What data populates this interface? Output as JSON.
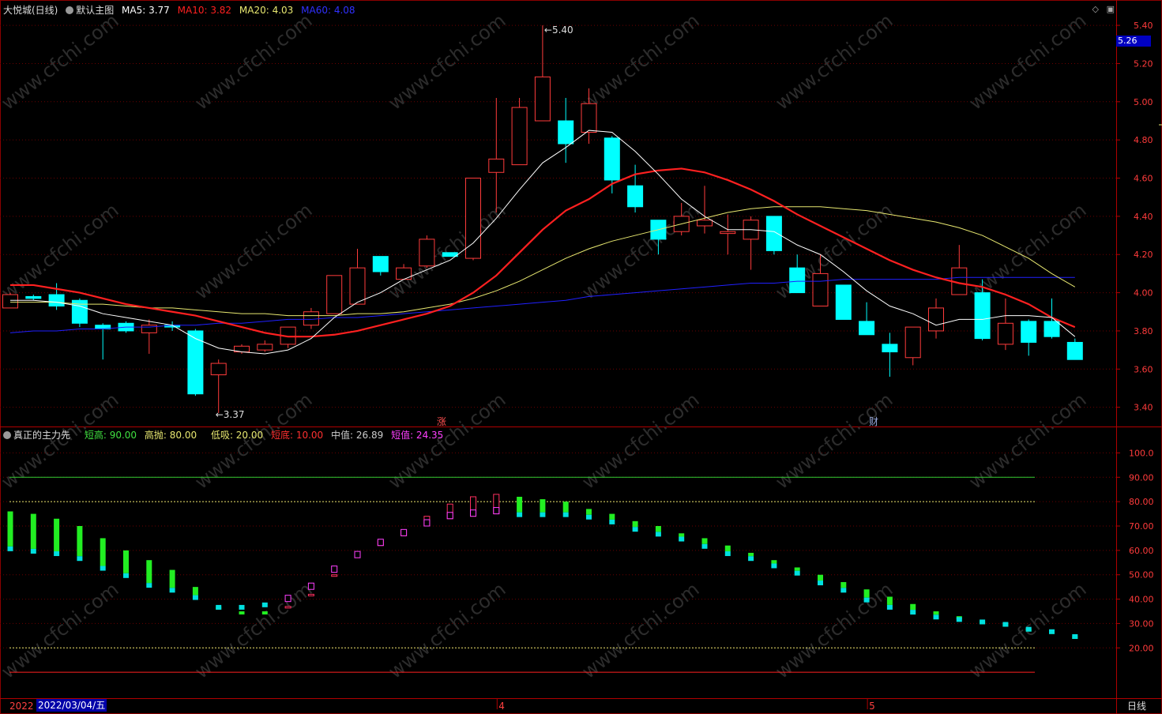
{
  "main_header": {
    "title": "大悦城(日线)",
    "template": "默认主图",
    "ma5": "MA5: 3.77",
    "ma10": "MA10: 3.82",
    "ma20": "MA20: 4.03",
    "ma60": "MA60: 4.08"
  },
  "indicator_header": {
    "name": "真正的主力先",
    "short_high": "短高: 90.00",
    "high_throw": "高抛: 80.00",
    "low_buy": "低吸: 20.00",
    "short_bottom": "短底: 10.00",
    "mid_value": "中值: 26.89",
    "short_value": "短值: 24.35"
  },
  "current_price": "5.26",
  "price_axis": [
    "5.40",
    "5.20",
    "5.00",
    "4.80",
    "4.60",
    "4.40",
    "4.20",
    "4.00",
    "3.80",
    "3.60",
    "3.40"
  ],
  "ind_axis": [
    "100.0",
    "90.00",
    "80.00",
    "70.00",
    "60.00",
    "50.00",
    "40.00",
    "30.00",
    "20.00"
  ],
  "annotations": {
    "high": "5.40",
    "low": "3.37",
    "mark1": "涨",
    "mark2": "财"
  },
  "date_prefix": "2022",
  "cursor_date": "2022/03/04/五",
  "x_labels": [
    "4",
    "5"
  ],
  "period": "日线",
  "watermark": "www.cfchi.com",
  "colors": {
    "up": "#ff3b3b",
    "down": "#00ffff",
    "ma5": "#ffffff",
    "ma10": "#ff2020",
    "ma20": "#e8e870",
    "ma60": "#2020ff"
  },
  "chart_data": {
    "type": "candlestick",
    "ohlc": [
      [
        3.92,
        3.99,
        3.92,
        4.0
      ],
      [
        3.98,
        3.97,
        3.96,
        3.99
      ],
      [
        3.99,
        3.93,
        3.91,
        4.05
      ],
      [
        3.96,
        3.84,
        3.82,
        3.97
      ],
      [
        3.83,
        3.81,
        3.65,
        3.84
      ],
      [
        3.84,
        3.8,
        3.79,
        3.85
      ],
      [
        3.79,
        3.83,
        3.68,
        3.86
      ],
      [
        3.83,
        3.82,
        3.8,
        3.85
      ],
      [
        3.8,
        3.47,
        3.46,
        3.81
      ],
      [
        3.57,
        3.63,
        3.37,
        3.65
      ],
      [
        3.69,
        3.72,
        3.68,
        3.73
      ],
      [
        3.7,
        3.73,
        3.69,
        3.75
      ],
      [
        3.73,
        3.82,
        3.71,
        3.82
      ],
      [
        3.83,
        3.9,
        3.81,
        3.92
      ],
      [
        3.89,
        4.09,
        3.89,
        4.09
      ],
      [
        3.94,
        4.13,
        3.94,
        4.23
      ],
      [
        4.19,
        4.11,
        4.09,
        4.19
      ],
      [
        4.07,
        4.13,
        4.07,
        4.15
      ],
      [
        4.14,
        4.28,
        4.13,
        4.3
      ],
      [
        4.21,
        4.19,
        4.19,
        4.21
      ],
      [
        4.18,
        4.6,
        4.17,
        4.6
      ],
      [
        4.63,
        4.7,
        4.42,
        5.02
      ],
      [
        4.67,
        4.97,
        4.67,
        5.02
      ],
      [
        4.9,
        5.13,
        4.9,
        5.4
      ],
      [
        4.9,
        4.78,
        4.68,
        5.02
      ],
      [
        4.84,
        4.99,
        4.78,
        5.07
      ],
      [
        4.81,
        4.59,
        4.52,
        4.82
      ],
      [
        4.56,
        4.45,
        4.42,
        4.67
      ],
      [
        4.38,
        4.28,
        4.2,
        4.38
      ],
      [
        4.32,
        4.4,
        4.3,
        4.47
      ],
      [
        4.35,
        4.38,
        4.31,
        4.56
      ],
      [
        4.31,
        4.32,
        4.2,
        4.41
      ],
      [
        4.28,
        4.38,
        4.12,
        4.4
      ],
      [
        4.4,
        4.22,
        4.2,
        4.4
      ],
      [
        4.13,
        4.0,
        4.0,
        4.2
      ],
      [
        3.93,
        4.1,
        3.93,
        4.2
      ],
      [
        4.04,
        3.86,
        3.86,
        4.04
      ],
      [
        3.85,
        3.78,
        3.78,
        3.95
      ],
      [
        3.73,
        3.69,
        3.56,
        3.79
      ],
      [
        3.66,
        3.82,
        3.62,
        3.82
      ],
      [
        3.8,
        3.92,
        3.76,
        3.97
      ],
      [
        3.99,
        4.13,
        3.99,
        4.25
      ],
      [
        4.0,
        3.76,
        3.75,
        4.07
      ],
      [
        3.73,
        3.84,
        3.7,
        3.97
      ],
      [
        3.85,
        3.74,
        3.67,
        3.86
      ],
      [
        3.85,
        3.77,
        3.76,
        3.97
      ],
      [
        3.74,
        3.65,
        3.65,
        3.76
      ]
    ],
    "ma5": [
      3.96,
      3.96,
      3.95,
      3.93,
      3.89,
      3.87,
      3.85,
      3.83,
      3.76,
      3.71,
      3.69,
      3.68,
      3.7,
      3.76,
      3.87,
      3.95,
      4.0,
      4.07,
      4.12,
      4.17,
      4.26,
      4.39,
      4.54,
      4.68,
      4.76,
      4.85,
      4.84,
      4.74,
      4.62,
      4.49,
      4.4,
      4.33,
      4.33,
      4.32,
      4.25,
      4.2,
      4.11,
      4.01,
      3.93,
      3.89,
      3.83,
      3.86,
      3.86,
      3.88,
      3.88,
      3.87,
      3.77
    ],
    "ma10": [
      4.04,
      4.04,
      4.02,
      4.0,
      3.97,
      3.94,
      3.92,
      3.9,
      3.88,
      3.85,
      3.82,
      3.79,
      3.77,
      3.77,
      3.78,
      3.8,
      3.83,
      3.86,
      3.89,
      3.93,
      4.0,
      4.09,
      4.21,
      4.33,
      4.43,
      4.49,
      4.57,
      4.62,
      4.64,
      4.65,
      4.63,
      4.59,
      4.54,
      4.48,
      4.41,
      4.35,
      4.29,
      4.23,
      4.17,
      4.12,
      4.08,
      4.05,
      4.03,
      3.99,
      3.94,
      3.87,
      3.82
    ],
    "ma20": [
      3.95,
      3.95,
      3.95,
      3.94,
      3.94,
      3.93,
      3.92,
      3.92,
      3.91,
      3.9,
      3.89,
      3.89,
      3.88,
      3.88,
      3.88,
      3.89,
      3.89,
      3.9,
      3.92,
      3.94,
      3.97,
      4.01,
      4.06,
      4.12,
      4.18,
      4.23,
      4.27,
      4.3,
      4.33,
      4.36,
      4.39,
      4.42,
      4.44,
      4.45,
      4.45,
      4.45,
      4.44,
      4.43,
      4.41,
      4.39,
      4.37,
      4.34,
      4.3,
      4.24,
      4.18,
      4.1,
      4.03
    ],
    "ma60": [
      3.79,
      3.8,
      3.8,
      3.81,
      3.81,
      3.82,
      3.82,
      3.83,
      3.83,
      3.84,
      3.84,
      3.85,
      3.86,
      3.86,
      3.87,
      3.87,
      3.88,
      3.89,
      3.9,
      3.91,
      3.92,
      3.93,
      3.94,
      3.95,
      3.96,
      3.98,
      3.99,
      4.0,
      4.01,
      4.02,
      4.03,
      4.04,
      4.05,
      4.05,
      4.06,
      4.06,
      4.07,
      4.07,
      4.07,
      4.07,
      4.07,
      4.08,
      4.08,
      4.08,
      4.08,
      4.08,
      4.08
    ],
    "indicator": {
      "mid": [
        76,
        75,
        73,
        70,
        65,
        60,
        56,
        52,
        45,
        37,
        35,
        35,
        37,
        42,
        50,
        58,
        64,
        68,
        74,
        79,
        82,
        83,
        82,
        81,
        80,
        77,
        75,
        72,
        70,
        67,
        65,
        62,
        59,
        56,
        53,
        50,
        47,
        44,
        41,
        38,
        35,
        33,
        31,
        30,
        28,
        27,
        25
      ],
      "short": [
        60,
        59,
        58,
        56,
        52,
        49,
        45,
        43,
        40,
        36,
        36,
        37,
        39,
        44,
        51,
        57,
        62,
        66,
        70,
        73,
        74,
        75,
        74,
        74,
        74,
        73,
        71,
        68,
        66,
        64,
        61,
        58,
        56,
        53,
        50,
        46,
        43,
        39,
        36,
        34,
        32,
        31,
        30,
        29,
        27,
        26,
        24
      ]
    },
    "price_range": [
      3.32,
      5.45
    ],
    "ind_range": [
      0,
      105
    ]
  }
}
